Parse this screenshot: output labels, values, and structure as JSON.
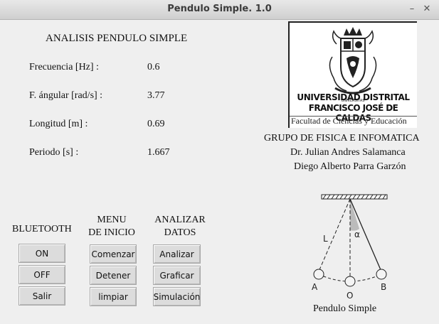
{
  "window": {
    "title": "Pendulo Simple. 1.0",
    "minimize_glyph": "–",
    "close_glyph": "✕"
  },
  "analysis": {
    "heading": "ANALISIS PENDULO SIMPLE",
    "rows": [
      {
        "label": "Frecuencia [Hz] :",
        "value": "0.6"
      },
      {
        "label": "F. ángular [rad/s] :",
        "value": "3.77"
      },
      {
        "label": "Longitud [m] :",
        "value": "0.69"
      },
      {
        "label": "Periodo [s] :",
        "value": "1.667"
      }
    ]
  },
  "logo": {
    "line1": "UNIVERSIDAD DISTRITAL",
    "line2": "FRANCISCO JOSÉ DE CALDAS",
    "line3": "Facultad de Ciencias y Educación"
  },
  "credits": {
    "group": "GRUPO DE FISICA E INFOMATICA",
    "author1": "Dr. Julian Andres Salamanca",
    "author2": "Diego Alberto Parra Garzón"
  },
  "bluetooth": {
    "heading": "BLUETOOTH",
    "buttons": [
      "ON",
      "OFF",
      "Salir"
    ]
  },
  "menu": {
    "heading1": "MENU",
    "heading2": "DE INICIO",
    "buttons": [
      "Comenzar",
      "Detener",
      "limpiar"
    ]
  },
  "analyze": {
    "heading1": "ANALIZAR",
    "heading2": "DATOS",
    "buttons": [
      "Analizar",
      "Graficar",
      "Simulación"
    ]
  },
  "diagram": {
    "caption": "Pendulo Simple",
    "label_L": "L",
    "label_alpha": "α",
    "label_A": "A",
    "label_O": "O",
    "label_B": "B"
  }
}
